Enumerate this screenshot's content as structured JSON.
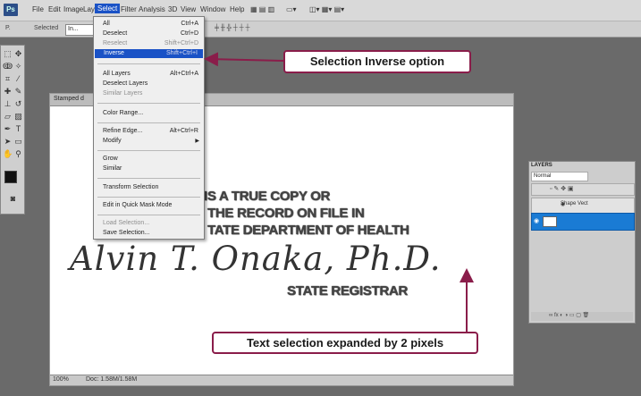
{
  "menubar": {
    "items": [
      "File",
      "Edit",
      "Image",
      "Layer",
      "Select",
      "Filter",
      "Analysis",
      "3D",
      "View",
      "Window",
      "Help"
    ],
    "active_index": 4
  },
  "options_bar": {
    "tool_preset": "P.",
    "selection_label": "Selected",
    "mode_value": "In..."
  },
  "document": {
    "tab_title": "Stamped d",
    "status_zoom": "100%",
    "status_info": "Doc: 1.58M/1.58M",
    "lines": [
      "IS A TRUE COPY OR",
      "THE RECORD ON FILE IN",
      "TATE DEPARTMENT OF HEALTH"
    ],
    "signature": "Alvin T. Onaka, Ph.D.",
    "registrar": "STATE REGISTRAR"
  },
  "select_menu": {
    "items": [
      {
        "label": "All",
        "shortcut": "Ctrl+A",
        "disabled": false
      },
      {
        "label": "Deselect",
        "shortcut": "Ctrl+D",
        "disabled": false
      },
      {
        "label": "Reselect",
        "shortcut": "Shift+Ctrl+D",
        "disabled": true
      },
      {
        "label": "Inverse",
        "shortcut": "Shift+Ctrl+I",
        "disabled": false,
        "highlighted": true
      },
      {
        "label": "All Layers",
        "shortcut": "Alt+Ctrl+A",
        "disabled": false
      },
      {
        "label": "Deselect Layers",
        "shortcut": "",
        "disabled": false
      },
      {
        "label": "Similar Layers",
        "shortcut": "",
        "disabled": true
      },
      {
        "label": "Color Range...",
        "shortcut": "",
        "disabled": false
      },
      {
        "label": "Refine Edge...",
        "shortcut": "Alt+Ctrl+R",
        "disabled": false
      },
      {
        "label": "Modify",
        "shortcut": "",
        "disabled": false,
        "submenu": true
      },
      {
        "label": "Grow",
        "shortcut": "",
        "disabled": false
      },
      {
        "label": "Similar",
        "shortcut": "",
        "disabled": false
      },
      {
        "label": "Transform Selection",
        "shortcut": "",
        "disabled": false
      },
      {
        "label": "Edit in Quick Mask Mode",
        "shortcut": "",
        "disabled": false
      },
      {
        "label": "Load Selection...",
        "shortcut": "",
        "disabled": true
      },
      {
        "label": "Save Selection...",
        "shortcut": "",
        "disabled": false
      }
    ]
  },
  "callouts": {
    "inverse": "Selection Inverse option",
    "expanded": "Text selection expanded by 2 pixels"
  },
  "layers_panel": {
    "tab": "LAYERS",
    "blend_mode": "Normal",
    "shape_layer": "Shape Vect",
    "colors": {
      "selected": "#1a7bd4"
    }
  },
  "colors": {
    "accent": "#1a52c6",
    "callout_border": "#8a1d4a"
  }
}
